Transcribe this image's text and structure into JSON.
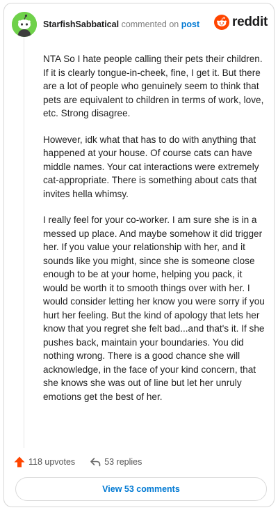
{
  "header": {
    "username": "StarfishSabbatical",
    "action_text": "commented on",
    "post_link": "post",
    "brand": "reddit"
  },
  "comment": {
    "paragraphs": [
      "NTA So I hate people calling their pets their children. If it is clearly tongue-in-cheek, fine, I get it. But there are a lot of people who genuinely seem to think that pets are equivalent to children in terms of work, love, etc. Strong disagree.",
      "However, idk what that has to do with anything that happened at your house. Of course cats can have middle names. Your cat interactions were extremely cat-appropriate. There is something about cats that invites hella whimsy.",
      "I really feel for your co-worker. I am sure she is in a messed up place. And maybe somehow it did trigger her. If you value your relationship with her, and it sounds like you might, since she is someone close enough to be at your home, helping you pack, it would be worth it to smooth things over with her. I would consider letting her know you were sorry if you hurt her feeling. But the kind of apology that lets her know that you regret she felt bad...and that's it. If she pushes back, maintain your boundaries. You did nothing wrong. There is a good chance she will acknowledge, in the face of your kind concern, that she knows she was out of line but let her unruly emotions get the best of her."
    ]
  },
  "actions": {
    "upvotes": "118 upvotes",
    "replies": "53 replies",
    "view_comments": "View 53 comments"
  },
  "colors": {
    "upvote": "#ff4500",
    "link": "#0079d3",
    "avatar_bg": "#6fd14a",
    "reddit_orange": "#ff4500"
  },
  "icons": {
    "avatar": "snoo-avatar",
    "logo": "reddit-logo-icon",
    "upvote": "upvote-arrow-icon",
    "reply": "reply-arrow-icon"
  }
}
